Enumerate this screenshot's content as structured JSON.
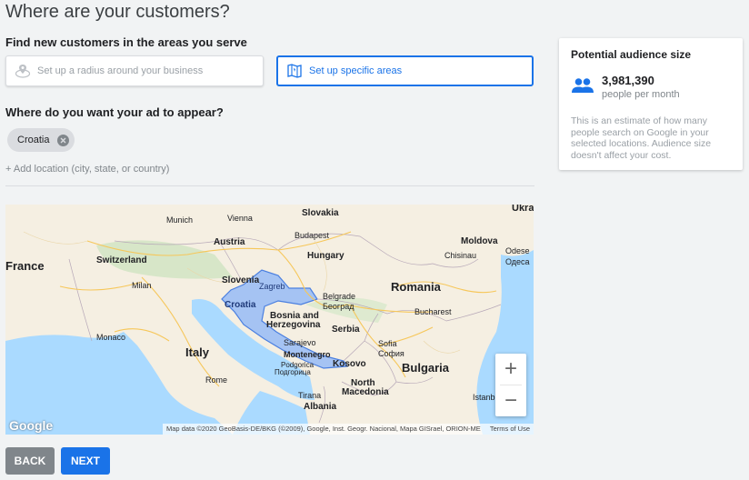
{
  "header": {
    "title": "Where are your customers?"
  },
  "targeting": {
    "find_label": "Find new customers in the areas you serve",
    "option_radius": "Set up a radius around your business",
    "option_areas": "Set up specific areas",
    "where_label": "Where do you want your ad to appear?",
    "chips": [
      "Croatia"
    ],
    "add_location": "+ Add location (city, state, or country)"
  },
  "map": {
    "labels": {
      "ukra": "Ukra",
      "slovakia": "Slovakia",
      "vienna": "Vienna",
      "munich": "Munich",
      "austria": "Austria",
      "budapest": "Budapest",
      "moldova": "Moldova",
      "chisinau": "Chisinau",
      "odesa": "Odese",
      "odesa2": "Одеса",
      "france": "France",
      "switzerland": "Switzerland",
      "hungary": "Hungary",
      "slovenia": "Slovenia",
      "zagreb": "Zagreb",
      "milan": "Milan",
      "croatia": "Croatia",
      "belgrade": "Belgrade",
      "belgrade2": "Београд",
      "romania": "Romania",
      "bosnia": "Bosnia and",
      "herzegovina": "Herzegovina",
      "serbia": "Serbia",
      "bucharest": "Bucharest",
      "monaco": "Monaco",
      "sarajevo": "Sarajevo",
      "sofia": "Sofia",
      "sofia2": "София",
      "italy": "Italy",
      "montenegro": "Montenegro",
      "podgorica": "Podgorica",
      "podgorica2": "Подгорица",
      "kosovo": "Kosovo",
      "bulgaria": "Bulgaria",
      "rome": "Rome",
      "north": "North",
      "macedonia": "Macedonia",
      "tirana": "Tirana",
      "albania": "Albania",
      "istanbul": "Istanb"
    },
    "logo": "Google",
    "attribution": "Map data ©2020 GeoBasis-DE/BKG (©2009), Google, Inst. Geogr. Nacional, Mapa GISrael, ORION-ME",
    "terms": "Terms of Use",
    "zoom_in": "+",
    "zoom_out": "−"
  },
  "actions": {
    "back": "BACK",
    "next": "NEXT"
  },
  "audience": {
    "title": "Potential audience size",
    "count": "3,981,390",
    "unit": "people per month",
    "note": "This is an estimate of how many people search on Google in your selected locations. Audience size doesn't affect your cost."
  },
  "colors": {
    "accent": "#1a73e8",
    "highlight_region": "#8ab4f8",
    "water": "#aadaff",
    "land": "#f5efe2"
  }
}
